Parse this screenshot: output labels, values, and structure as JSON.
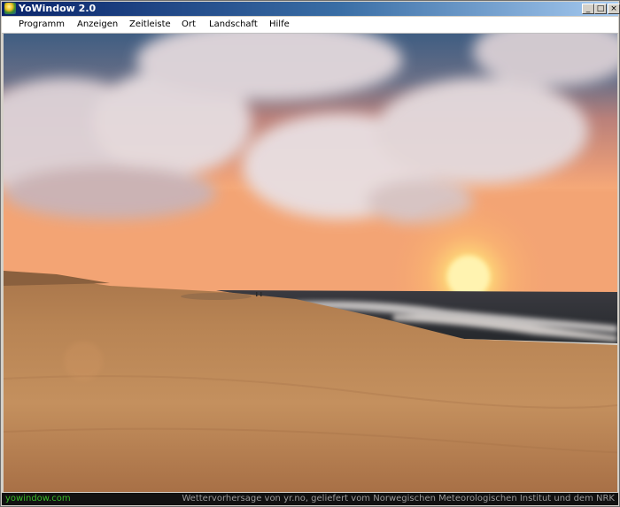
{
  "window": {
    "title": "YoWindow 2.0"
  },
  "title_buttons": {
    "minimize": "_",
    "maximize": "□",
    "close": "×"
  },
  "menu": {
    "items": [
      {
        "label": "Programm"
      },
      {
        "label": "Anzeigen"
      },
      {
        "label": "Zeitleiste"
      },
      {
        "label": "Ort"
      },
      {
        "label": "Landschaft"
      },
      {
        "label": "Hilfe"
      }
    ]
  },
  "scene": {
    "description_icon": "beach-sunset-scene"
  },
  "status": {
    "link": "yowindow.com",
    "forecast_credit": "Wettervorhersage von yr.no, geliefert vom Norwegischen Meteorologischen Institut und dem NRK"
  },
  "colors": {
    "titlebar_start": "#0a246a",
    "titlebar_end": "#a6caf0",
    "status_link": "#3bbd2a"
  }
}
